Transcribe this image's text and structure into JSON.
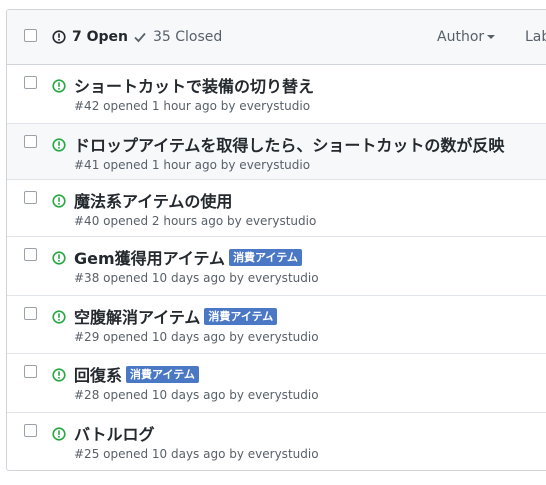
{
  "header": {
    "open_label": "7 Open",
    "closed_label": "35 Closed",
    "author_label": "Author",
    "labels_label": "Labels",
    "colors": {
      "open_icon": "#24292e",
      "check": "#586069"
    }
  },
  "issues": [
    {
      "title": "ショートカットで装備の切り替え",
      "meta": "#42 opened 1 hour ago by everystudio",
      "label": ""
    },
    {
      "title": "ドロップアイテムを取得したら、ショートカットの数が反映",
      "meta": "#41 opened 1 hour ago by everystudio",
      "label": ""
    },
    {
      "title": "魔法系アイテムの使用",
      "meta": "#40 opened 2 hours ago by everystudio",
      "label": ""
    },
    {
      "title": "Gem獲得用アイテム",
      "meta": "#38 opened 10 days ago by everystudio",
      "label": "消費アイテム"
    },
    {
      "title": "空腹解消アイテム",
      "meta": "#29 opened 10 days ago by everystudio",
      "label": "消費アイテム"
    },
    {
      "title": "回復系",
      "meta": "#28 opened 10 days ago by everystudio",
      "label": "消費アイテム"
    },
    {
      "title": "バトルログ",
      "meta": "#25 opened 10 days ago by everystudio",
      "label": ""
    }
  ],
  "colors": {
    "open_green": "#28a745",
    "label_bg": "#4a78c4",
    "label_text": "#ffffff"
  },
  "icons": {
    "open_issue": "issue-opened-icon",
    "closed": "check-icon"
  }
}
